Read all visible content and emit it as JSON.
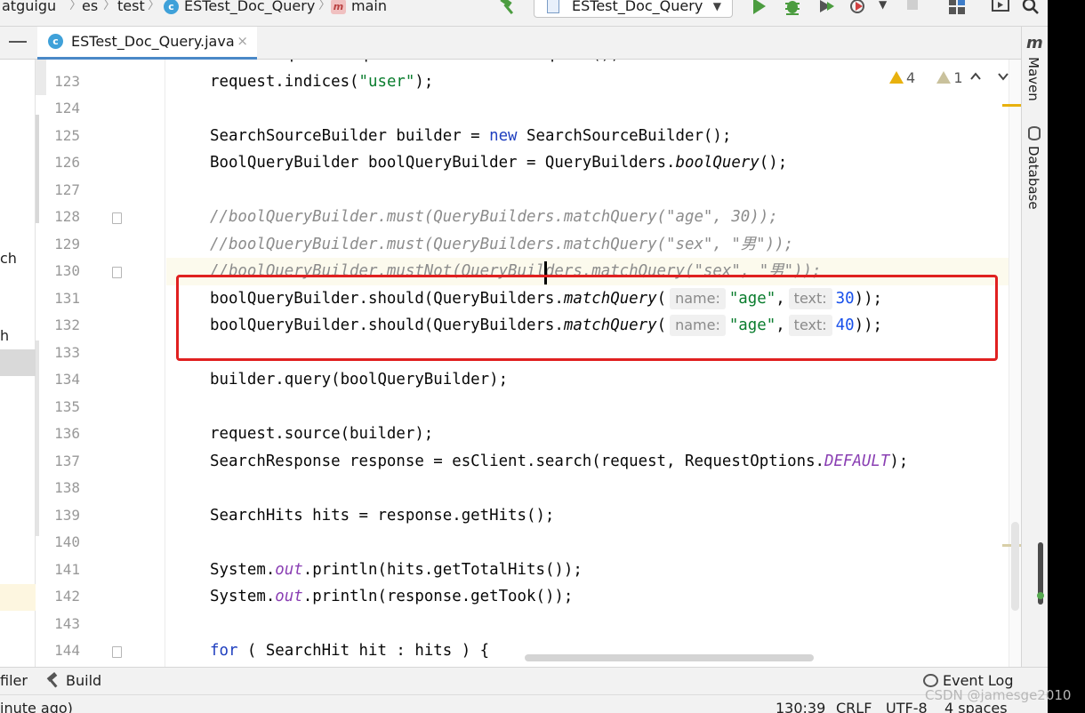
{
  "breadcrumb": {
    "items": [
      "atguigu",
      "es",
      "test",
      "ESTest_Doc_Query",
      "main"
    ]
  },
  "run_config": {
    "label": "ESTest_Doc_Query"
  },
  "editor_tab": {
    "label": "ESTest_Doc_Query.java",
    "close_glyph": "×"
  },
  "left_panel": {
    "fragments": [
      "ch",
      "h"
    ]
  },
  "inspections": {
    "warnings": "4",
    "weak_warnings": "1"
  },
  "gutter": {
    "lines": [
      "123",
      "124",
      "125",
      "126",
      "127",
      "128",
      "129",
      "130",
      "131",
      "132",
      "133",
      "134",
      "135",
      "136",
      "137",
      "138",
      "139",
      "140",
      "141",
      "142",
      "143",
      "144"
    ]
  },
  "code": {
    "l123": {
      "a": "request.indices(",
      "s": "\"user\"",
      "b": ");"
    },
    "l125": {
      "a": "SearchSourceBuilder builder = ",
      "kw": "new",
      "b": " SearchSourceBuilder();"
    },
    "l126": {
      "a": "BoolQueryBuilder boolQueryBuilder = QueryBuilders.",
      "i": "boolQuery",
      "b": "();"
    },
    "l128": "//boolQueryBuilder.must(QueryBuilders.matchQuery(\"age\", 30));",
    "l129": "//boolQueryBuilder.must(QueryBuilders.matchQuery(\"sex\", \"男\"));",
    "l130": "//boolQueryBuilder.mustNot(QueryBuilders.matchQuery(\"sex\", \"男\"));",
    "l131": {
      "a": "boolQueryBuilder.should(QueryBuilders.",
      "i": "matchQuery",
      "p": "(",
      "h1": "name:",
      "s": "\"age\"",
      "c": ",",
      "h2": "text:",
      "n": "30",
      "b": "));"
    },
    "l132": {
      "a": "boolQueryBuilder.should(QueryBuilders.",
      "i": "matchQuery",
      "p": "(",
      "h1": "name:",
      "s": "\"age\"",
      "c": ",",
      "h2": "text:",
      "n": "40",
      "b": "));"
    },
    "l134": "builder.query(boolQueryBuilder);",
    "l136": "request.source(builder);",
    "l137": {
      "a": "SearchResponse response = esClient.search(request, RequestOptions.",
      "st": "DEFAULT",
      "b": ");"
    },
    "l139": "SearchHits hits = response.getHits();",
    "l141": {
      "a": "System.",
      "st": "out",
      "b": ".println(hits.getTotalHits());"
    },
    "l142": {
      "a": "System.",
      "st": "out",
      "b": ".println(response.getTook());"
    },
    "l144": {
      "kw": "for",
      "b": " ( SearchHit hit : hits ) {"
    }
  },
  "right_strip": {
    "maven": "Maven",
    "database": "Database"
  },
  "tool_windows": {
    "profiler": "filer",
    "build": "Build",
    "event_log": "Event Log"
  },
  "status": {
    "message": "inute ago)",
    "position": "130:39",
    "line_sep": "CRLF",
    "encoding": "UTF-8",
    "indent": "4 spaces"
  },
  "watermark": "CSDN @jamesge2010",
  "colors": {
    "keyword": "#1f3fbf",
    "string": "#0a7d2e",
    "number": "#1750eb",
    "static_field": "#8a3fb3",
    "comment": "#8c8c8c",
    "highlight_box": "#e02020",
    "tab_underline": "#4a88c7",
    "run_green": "#4b9c3f",
    "warning": "#e8b10e"
  }
}
